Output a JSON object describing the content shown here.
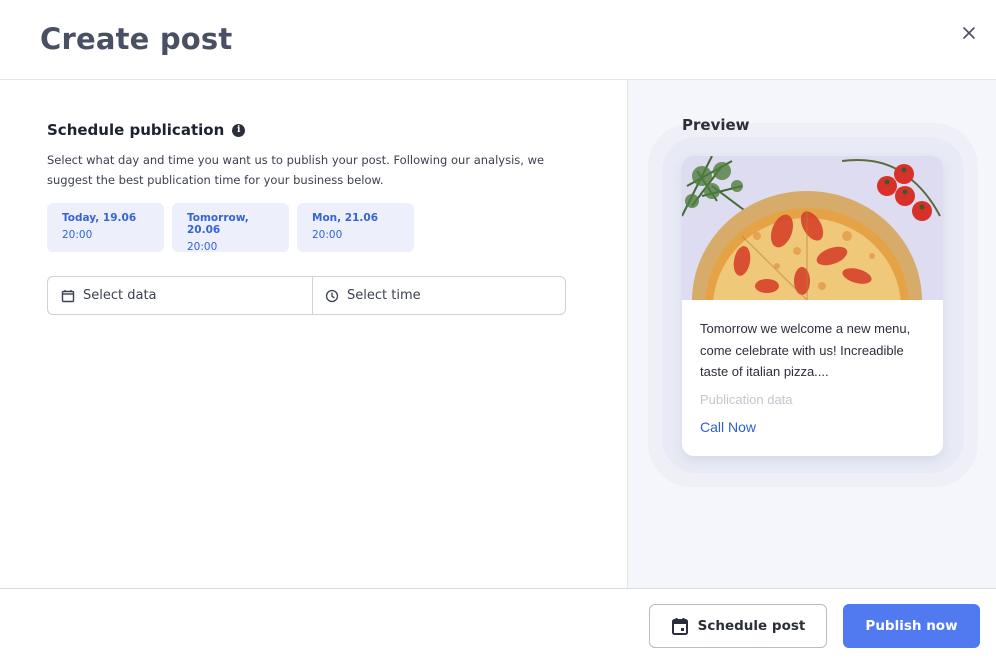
{
  "header": {
    "title": "Create post",
    "close_icon": "close-icon"
  },
  "schedule": {
    "title": "Schedule publication",
    "info_icon": "info-icon",
    "description": "Select what day and time you want us to publish your post. Following our analysis, we suggest the best publication time for your business below.",
    "suggestions": [
      {
        "day": "Today, 19.06",
        "time": "20:00"
      },
      {
        "day": "Tomorrow, 20.06",
        "time": "20:00"
      },
      {
        "day": "Mon, 21.06",
        "time": "20:00"
      }
    ],
    "date_placeholder": "Select data",
    "time_placeholder": "Select time",
    "date_icon": "calendar-icon",
    "time_icon": "clock-icon"
  },
  "preview": {
    "label": "Preview",
    "image": "pizza-photo",
    "text": "Tomorrow we welcome a new menu, come celebrate with us! Increadible taste of italian pizza....",
    "publication_date": "Publication data",
    "cta": "Call Now"
  },
  "footer": {
    "schedule_label": "Schedule post",
    "publish_label": "Publish now"
  },
  "colors": {
    "primary": "#5179f0",
    "link": "#2f5fd0",
    "chip_bg": "#edf0fb",
    "preview_bg": "#f5f6fb"
  }
}
